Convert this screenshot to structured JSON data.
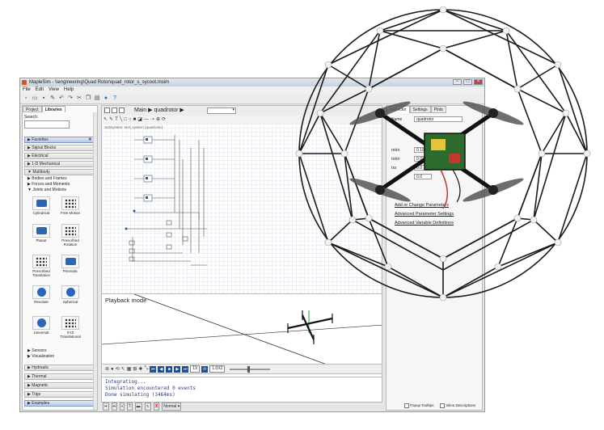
{
  "window": {
    "title": "MapleSim - \\\\engineering\\Quad Rotor\\quad_rotor_s_sycoot.msim",
    "buttons": [
      "−",
      "□",
      "×"
    ]
  },
  "menu": [
    "File",
    "Edit",
    "View",
    "Help"
  ],
  "left_panel": {
    "tabs": [
      "Project",
      "Libraries"
    ],
    "search_label": "Search:",
    "categories": [
      "Favorites",
      "Signal Blocks",
      "Electrical",
      "1-D Mechanical",
      "Multibody"
    ],
    "multibody_items": [
      "Bodies and Frames",
      "Forces and Moments",
      "Joints and Motions"
    ],
    "components": [
      "Cylindrical",
      "Free Motion",
      "Planar",
      "Prescribed Rotation",
      "Prescribed Translation",
      "Prismatic",
      "Revolute",
      "Spherical",
      "Universal",
      "XYZ Translational"
    ],
    "tail_items": [
      "Sensors",
      "Visualization"
    ],
    "bottom_categories": [
      "Hydraulic",
      "Thermal",
      "Magnetic",
      "Trigs",
      "Examples"
    ]
  },
  "diagram": {
    "breadcrumb_main": "Main",
    "breadcrumb_sub": "quadrotor",
    "subsystem_path": "Subsystem: test_system (quadrotor)"
  },
  "playback": {
    "label": "Playback mode",
    "speed": "1X",
    "time": "1.0X2"
  },
  "console": {
    "lines": [
      "Integrating...",
      "Simulation encountered 0 events",
      "Done simulating (3464ms)"
    ]
  },
  "bottom_bar": {
    "normal_label": "Normal"
  },
  "inspector": {
    "tabs": [
      "Inspector",
      "Settings",
      "Plots"
    ],
    "name_label": "Name",
    "name_value": "quadrotor",
    "params": [
      {
        "label": "rotor",
        "value": "0.19"
      },
      {
        "label": "rotor",
        "value": "0.02"
      },
      {
        "label": "Ixx",
        "value": "0.0"
      },
      {
        "label": "",
        "value": "0.0"
      }
    ],
    "links": [
      "Add or Change Parameters",
      "Advanced Parameter Settings",
      "Advanced Variable Definitions"
    ],
    "checks": [
      "Popup Tooltips",
      "Inline Descriptions"
    ]
  }
}
